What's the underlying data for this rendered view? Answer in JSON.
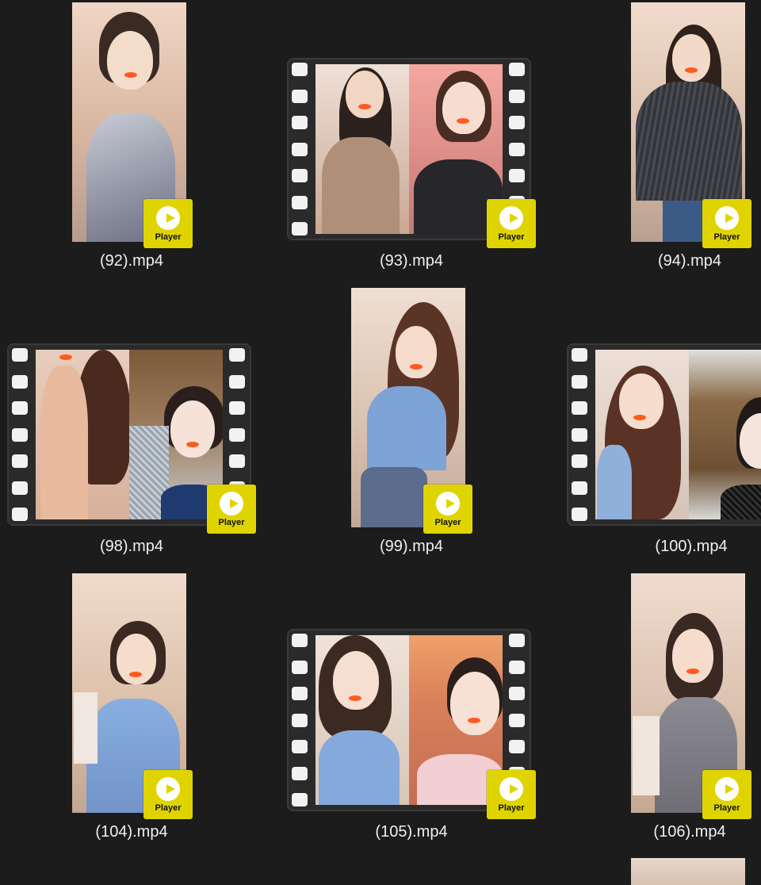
{
  "badge_label": "Player",
  "colors": {
    "background": "#1c1c1c",
    "badge": "#e0d400",
    "filename_text": "#f0f0f0"
  },
  "files": [
    {
      "name": "(92).mp4",
      "thumb": "portrait"
    },
    {
      "name": "(93).mp4",
      "thumb": "filmstrip"
    },
    {
      "name": "(94).mp4",
      "thumb": "portrait"
    },
    {
      "name": "(98).mp4",
      "thumb": "filmstrip"
    },
    {
      "name": "(99).mp4",
      "thumb": "portrait"
    },
    {
      "name": "(100).mp4",
      "thumb": "filmstrip"
    },
    {
      "name": "(104).mp4",
      "thumb": "portrait"
    },
    {
      "name": "(105).mp4",
      "thumb": "filmstrip"
    },
    {
      "name": "(106).mp4",
      "thumb": "portrait"
    }
  ]
}
